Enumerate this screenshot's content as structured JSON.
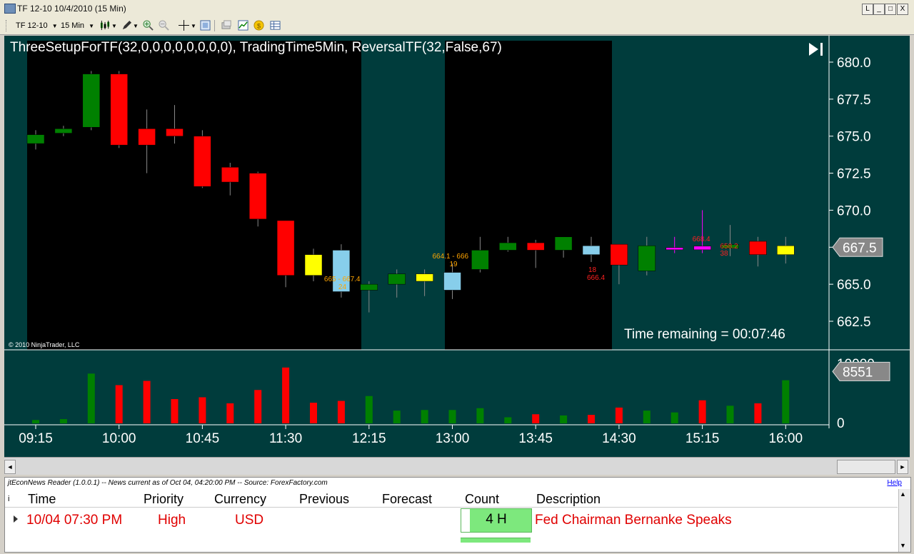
{
  "window": {
    "title": "TF 12-10  10/4/2010 (15 Min)",
    "buttons": [
      "L",
      "_",
      "□",
      "X"
    ]
  },
  "toolbar": {
    "instrument": "TF 12-10",
    "period": "15 Min",
    "icons": [
      "candlestick-icon",
      "pencil-icon",
      "zoom-in-icon",
      "zoom-out-icon",
      "crosshair-icon",
      "properties-icon",
      "data-box-icon",
      "strategy-icon",
      "coin-icon",
      "table-icon"
    ]
  },
  "chart": {
    "indicator_title": "ThreeSetupForTF(32,0,0,0,0,0,0,0,0), TradingTime5Min, ReversalTF(32,False,67)",
    "copyright": "© 2010 NinjaTrader, LLC",
    "time_remaining": "Time remaining = 00:07:46",
    "price_labels": [
      "680.0",
      "677.5",
      "675.0",
      "672.5",
      "670.0",
      "667.5",
      "665.0",
      "662.5"
    ],
    "price_values": [
      680.0,
      677.5,
      675.0,
      672.5,
      670.0,
      667.5,
      665.0,
      662.5
    ],
    "current_price": "667.5",
    "volume_axis_top": "10000",
    "volume_axis_zero": "0",
    "current_volume": "8551",
    "time_labels": [
      "09:15",
      "10:00",
      "10:45",
      "11:30",
      "12:15",
      "13:00",
      "13:45",
      "14:30",
      "15:15",
      "16:00"
    ],
    "annotations": [
      {
        "text": "665 - 667.4",
        "color": "#ffa500"
      },
      {
        "text": "24",
        "color": "#ffa500"
      },
      {
        "text": "664.1 - 666",
        "color": "#ffa500"
      },
      {
        "text": "19",
        "color": "#ffa500"
      },
      {
        "text": "18",
        "color": "#ff2020"
      },
      {
        "text": "666.4",
        "color": "#ff2020"
      },
      {
        "text": "668.4",
        "color": "#ff2020"
      },
      {
        "text": "658.2",
        "color": "#ff2020"
      },
      {
        "text": "38",
        "color": "#ff2020"
      }
    ],
    "colors": {
      "up": "#008000",
      "down": "#ff0000",
      "setup": "#ffff00",
      "signal": "#87ceeb",
      "doji": "#ff00ff",
      "session_bg": "#000000",
      "chart_bg": "#003c3c"
    }
  },
  "chart_data": {
    "type": "candlestick",
    "x": [
      "09:15",
      "09:30",
      "09:45",
      "10:00",
      "10:15",
      "10:30",
      "10:45",
      "11:00",
      "11:15",
      "11:30",
      "11:45",
      "12:00",
      "12:15",
      "12:30",
      "12:45",
      "13:00",
      "13:15",
      "13:30",
      "13:45",
      "14:00",
      "14:15",
      "14:30",
      "14:45",
      "15:00",
      "15:15",
      "15:30",
      "15:45",
      "16:00"
    ],
    "open": [
      674.5,
      675.2,
      675.6,
      679.2,
      675.5,
      675.5,
      675.0,
      672.9,
      672.5,
      669.3,
      667.0,
      667.3,
      664.6,
      665.0,
      665.2,
      664.6,
      666.0,
      667.3,
      667.8,
      667.3,
      667.6,
      667.7,
      665.9,
      667.4,
      667.5,
      667.5,
      667.9,
      667.0
    ],
    "high": [
      675.4,
      675.7,
      679.4,
      679.4,
      676.8,
      677.1,
      675.4,
      673.2,
      672.6,
      669.3,
      667.4,
      667.7,
      665.2,
      666.0,
      666.0,
      666.4,
      668.2,
      668.2,
      668.0,
      668.0,
      668.2,
      667.7,
      668.2,
      668.2,
      670.0,
      669.0,
      668.2,
      668.2
    ],
    "low": [
      674.1,
      675.0,
      675.4,
      674.2,
      672.5,
      674.5,
      671.5,
      671.0,
      668.9,
      664.8,
      665.2,
      664.1,
      663.1,
      664.1,
      664.2,
      664.0,
      665.8,
      667.2,
      666.1,
      666.8,
      666.5,
      665.0,
      665.6,
      667.1,
      667.1,
      666.9,
      666.2,
      666.4
    ],
    "close": [
      675.1,
      675.5,
      679.2,
      674.4,
      674.4,
      675.0,
      671.6,
      671.9,
      669.4,
      665.6,
      665.6,
      664.5,
      665.0,
      665.7,
      665.7,
      665.8,
      667.3,
      667.8,
      667.3,
      668.2,
      667.0,
      666.3,
      667.6,
      667.4,
      667.4,
      667.6,
      667.0,
      667.6
    ],
    "volume": [
      550,
      700,
      8200,
      6300,
      7000,
      4000,
      4300,
      3300,
      5500,
      9200,
      3400,
      3700,
      4500,
      2100,
      2200,
      2200,
      2500,
      1000,
      1500,
      1300,
      1400,
      2600,
      2100,
      1800,
      3800,
      2900,
      3300,
      7100
    ],
    "ylim": [
      661.0,
      681.0
    ],
    "volume_ylim": [
      0,
      10000
    ]
  },
  "news": {
    "info": "jtEconNews Reader (1.0.0.1)  --  News current as of Oct 04, 04:20:00 PM  --  Source: ForexFactory.com",
    "help": "Help",
    "columns": [
      "i",
      "Time",
      "Priority",
      "Currency",
      "Previous",
      "Forecast",
      "Count",
      "Description"
    ],
    "row": {
      "time": "10/04 07:30 PM",
      "priority": "High",
      "currency": "USD",
      "previous": "",
      "forecast": "",
      "count": "4 H",
      "description": "Fed Chairman Bernanke Speaks"
    }
  }
}
